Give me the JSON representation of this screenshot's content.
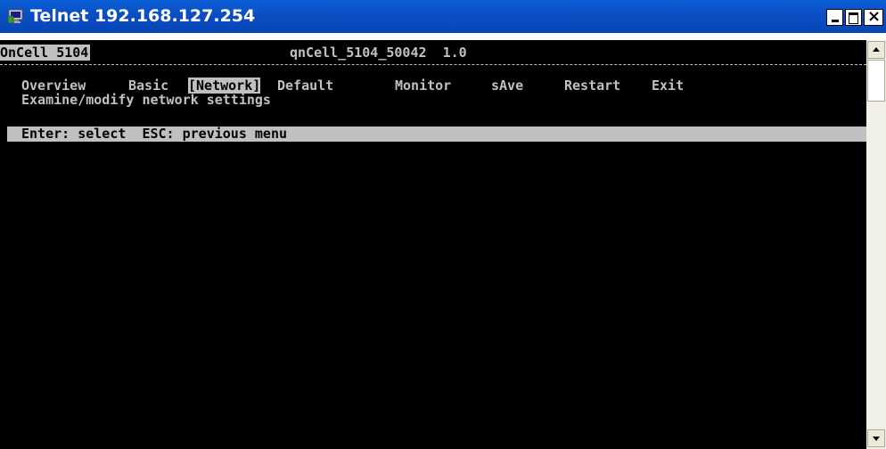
{
  "window": {
    "title": "Telnet 192.168.127.254",
    "icon": "telnet-terminal-icon",
    "controls": [
      "minimize-icon",
      "maximize-icon",
      "close-icon"
    ],
    "close_glyph": "×"
  },
  "terminal": {
    "device_name": "OnCell 5104",
    "device_info": "qnCell_5104_50042  1.0",
    "menu": [
      {
        "label": "Overview",
        "selected": false
      },
      {
        "label": "Basic",
        "selected": false
      },
      {
        "label": "[Network]",
        "selected": true
      },
      {
        "label": "Default",
        "selected": false
      },
      {
        "label": "Monitor",
        "selected": false
      },
      {
        "label": "sAve",
        "selected": false
      },
      {
        "label": "Restart",
        "selected": false
      },
      {
        "label": "Exit",
        "selected": false
      }
    ],
    "description": "Examine/modify network settings",
    "status_hint": "Enter: select  ESC: previous menu"
  },
  "colors": {
    "title_bar": "#0b4fc4",
    "terminal_bg": "#000000",
    "terminal_fg": "#c0c0c0",
    "highlight_bg": "#c0c0c0"
  }
}
